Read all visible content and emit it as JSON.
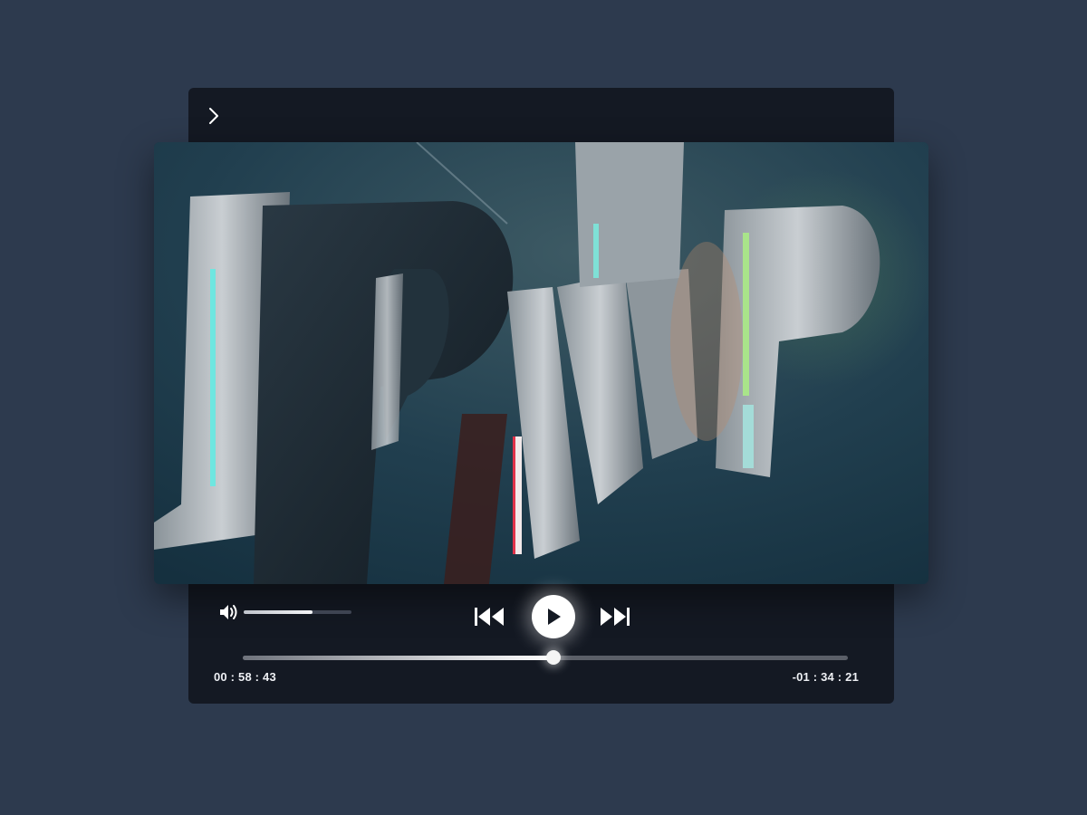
{
  "player": {
    "back_icon": "chevron-right-icon",
    "video": {
      "frame_description_icon": "video-frame",
      "accent_colors": [
        "#4fd6d0",
        "#9be07a",
        "#e0324a"
      ]
    },
    "controls": {
      "volume_icon": "speaker-volume-icon",
      "volume_level": 0.64,
      "prev_icon": "skip-back-icon",
      "play_icon": "play-icon",
      "next_icon": "skip-forward-icon"
    },
    "progress": {
      "fraction": 0.514,
      "elapsed": "00 : 58 : 43",
      "remaining": "-01 : 34 : 21"
    }
  },
  "colors": {
    "page_background": "#2d3a4e",
    "panel_background": "#141923",
    "accent_white": "#ffffff"
  }
}
